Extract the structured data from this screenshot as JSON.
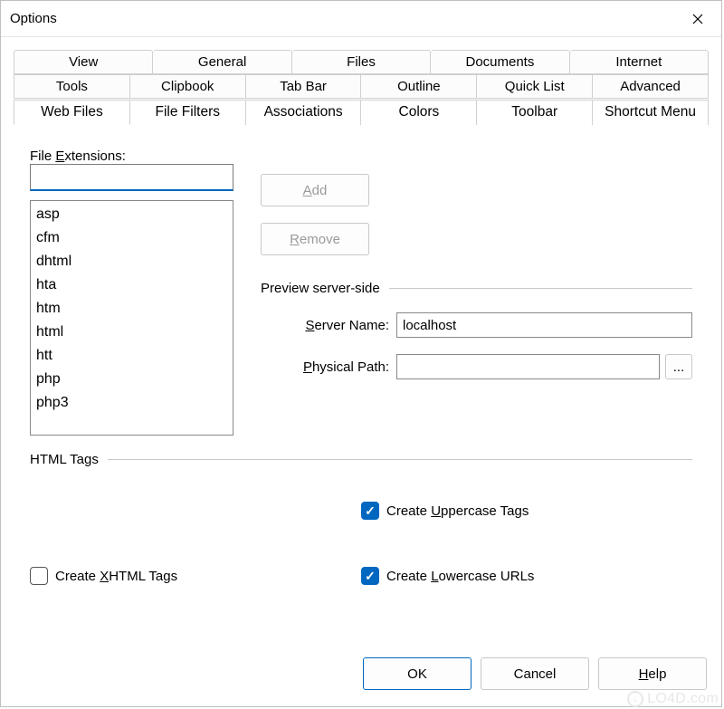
{
  "window": {
    "title": "Options"
  },
  "tabs": {
    "row1": [
      "View",
      "General",
      "Files",
      "Documents",
      "Internet"
    ],
    "row2": [
      "Tools",
      "Clipbook",
      "Tab Bar",
      "Outline",
      "Quick List",
      "Advanced"
    ],
    "row3": [
      "Web Files",
      "File Filters",
      "Associations",
      "Colors",
      "Toolbar",
      "Shortcut Menu"
    ],
    "active": "Web Files"
  },
  "webfiles": {
    "file_extensions_label": "File Extensions:",
    "file_extensions_input": "",
    "extensions": [
      "asp",
      "cfm",
      "dhtml",
      "hta",
      "htm",
      "html",
      "htt",
      "php",
      "php3"
    ],
    "add_label": "Add",
    "remove_label": "Remove",
    "preview_group": "Preview server-side",
    "server_name_label": "Server Name:",
    "server_name_value": "localhost",
    "physical_path_label": "Physical Path:",
    "physical_path_value": "",
    "browse_label": "...",
    "html_tags_group": "HTML Tags",
    "uppercase_label": "Create Uppercase Tags",
    "uppercase_checked": true,
    "xhtml_label": "Create XHTML Tags",
    "xhtml_checked": false,
    "lowercase_urls_label": "Create Lowercase URLs",
    "lowercase_urls_checked": true
  },
  "buttons": {
    "ok": "OK",
    "cancel": "Cancel",
    "help": "Help"
  },
  "watermark": "LO4D.com"
}
